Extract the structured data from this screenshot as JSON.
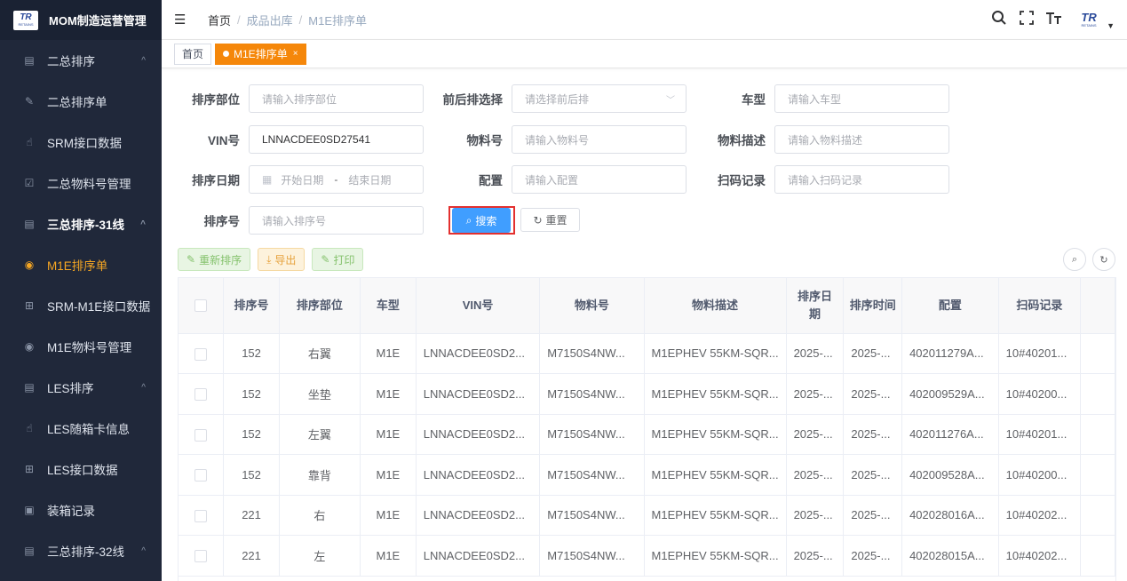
{
  "app": {
    "logo_text": "TR",
    "logo_sub": "RETAINS",
    "title": "MOM制造运营管理"
  },
  "sidebar": {
    "items": [
      {
        "label": "二总排序",
        "icon": "list-icon",
        "chevron": "^"
      },
      {
        "label": "二总排序单",
        "icon": "edit-icon"
      },
      {
        "label": "SRM接口数据",
        "icon": "hand-icon"
      },
      {
        "label": "二总物料号管理",
        "icon": "checkbox-icon"
      },
      {
        "label": "三总排序-31线",
        "icon": "list-icon",
        "chevron": "^"
      },
      {
        "label": "M1E排序单",
        "icon": "target-icon"
      },
      {
        "label": "SRM-M1E接口数据",
        "icon": "grid-icon"
      },
      {
        "label": "M1E物料号管理",
        "icon": "target-icon"
      },
      {
        "label": "LES排序",
        "icon": "list-icon",
        "chevron": "^"
      },
      {
        "label": "LES随箱卡信息",
        "icon": "hand-icon"
      },
      {
        "label": "LES接口数据",
        "icon": "grid-icon"
      },
      {
        "label": "装箱记录",
        "icon": "printer-icon"
      },
      {
        "label": "三总排序-32线",
        "icon": "list-icon",
        "chevron": "^"
      }
    ]
  },
  "header": {
    "breadcrumb": [
      "首页",
      "成品出库",
      "M1E排序单"
    ],
    "separator": "/"
  },
  "tags": {
    "home": "首页",
    "active": "M1E排序单",
    "close": "×"
  },
  "form": {
    "dept_label": "排序部位",
    "dept_placeholder": "请输入排序部位",
    "frontback_label": "前后排选择",
    "frontback_placeholder": "请选择前后排",
    "model_label": "车型",
    "model_placeholder": "请输入车型",
    "vin_label": "VIN号",
    "vin_value": "LNNACDEE0SD27541",
    "material_label": "物料号",
    "material_placeholder": "请输入物料号",
    "desc_label": "物料描述",
    "desc_placeholder": "请输入物料描述",
    "date_label": "排序日期",
    "date_start": "开始日期",
    "date_sep": "-",
    "date_end": "结束日期",
    "config_label": "配置",
    "config_placeholder": "请输入配置",
    "scan_label": "扫码记录",
    "scan_placeholder": "请输入扫码记录",
    "seq_label": "排序号",
    "seq_placeholder": "请输入排序号",
    "search_btn": "搜索",
    "reset_btn": "重置"
  },
  "toolbar": {
    "resort": "重新排序",
    "export": "导出",
    "print": "打印"
  },
  "table": {
    "headers": [
      "排序号",
      "排序部位",
      "车型",
      "VIN号",
      "物料号",
      "物料描述",
      "排序日期",
      "排序时间",
      "配置",
      "扫码记录"
    ],
    "rows": [
      [
        "152",
        "右翼",
        "M1E",
        "LNNACDEE0SD2...",
        "M7150S4NW...",
        "M1EPHEV 55KM-SQR...",
        "2025-...",
        "2025-...",
        "402011279A...",
        "10#40201..."
      ],
      [
        "152",
        "坐垫",
        "M1E",
        "LNNACDEE0SD2...",
        "M7150S4NW...",
        "M1EPHEV 55KM-SQR...",
        "2025-...",
        "2025-...",
        "402009529A...",
        "10#40200..."
      ],
      [
        "152",
        "左翼",
        "M1E",
        "LNNACDEE0SD2...",
        "M7150S4NW...",
        "M1EPHEV 55KM-SQR...",
        "2025-...",
        "2025-...",
        "402011276A...",
        "10#40201..."
      ],
      [
        "152",
        "靠背",
        "M1E",
        "LNNACDEE0SD2...",
        "M7150S4NW...",
        "M1EPHEV 55KM-SQR...",
        "2025-...",
        "2025-...",
        "402009528A...",
        "10#40200..."
      ],
      [
        "221",
        "右",
        "M1E",
        "LNNACDEE0SD2...",
        "M7150S4NW...",
        "M1EPHEV 55KM-SQR...",
        "2025-...",
        "2025-...",
        "402028016A...",
        "10#40202..."
      ],
      [
        "221",
        "左",
        "M1E",
        "LNNACDEE0SD2...",
        "M7150S4NW...",
        "M1EPHEV 55KM-SQR...",
        "2025-...",
        "2025-...",
        "402028015A...",
        "10#40202..."
      ]
    ]
  },
  "colors": {
    "sidebar_bg": "#20283a",
    "accent": "#f5870a",
    "primary": "#409eff",
    "highlight_border": "#e3302f"
  }
}
